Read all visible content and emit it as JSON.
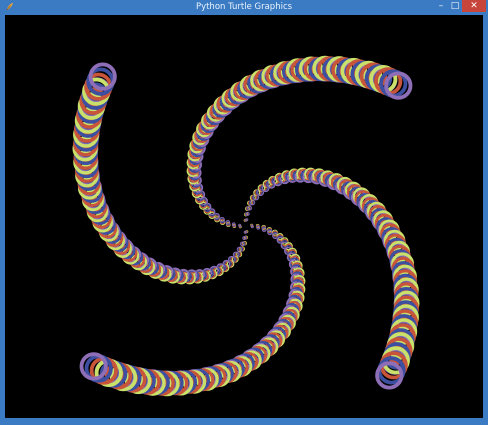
{
  "window": {
    "title": "Python Turtle Graphics",
    "icon": "feather-icon",
    "controls": {
      "minimize": "–",
      "maximize": "□",
      "close": "✕"
    }
  },
  "drawing": {
    "background": "#000000",
    "ring_colors": [
      "#c9e06a",
      "#c8553a",
      "#3c4fa0",
      "#8e6eb6"
    ],
    "arms": 4,
    "description_icon": "spiral-rings"
  }
}
